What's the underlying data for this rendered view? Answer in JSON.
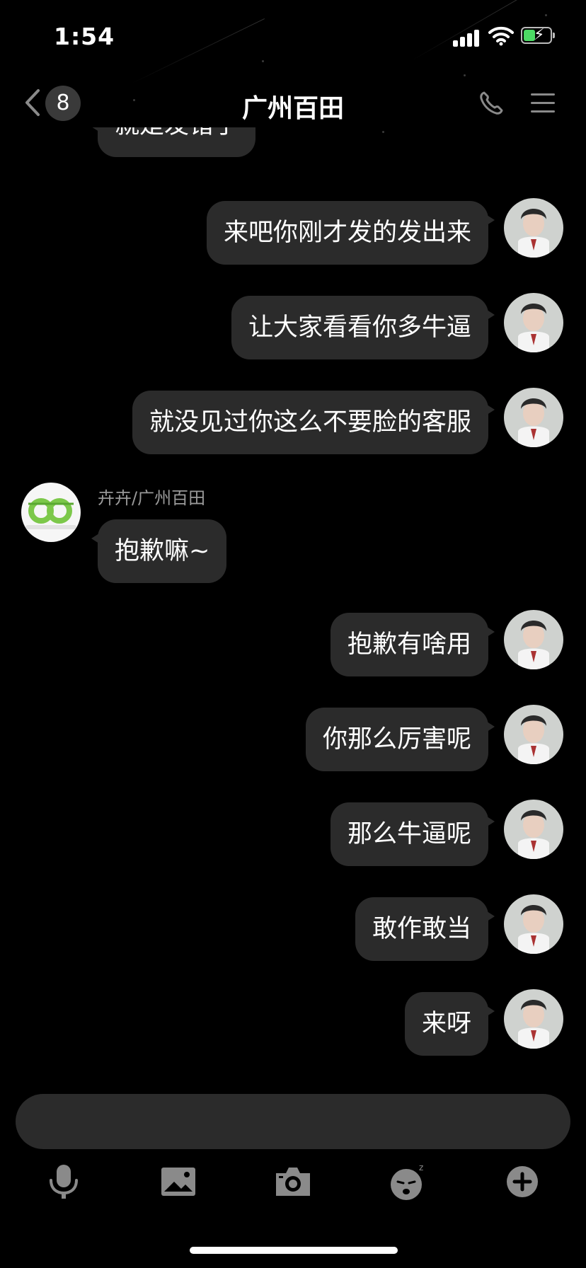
{
  "status_bar": {
    "time": "1:54"
  },
  "header": {
    "unread_count": "8",
    "title": "广州百田"
  },
  "messages": {
    "partial_top": "就是发错了",
    "out_1": "来吧你刚才发的发出来",
    "out_2": "让大家看看你多牛逼",
    "out_3": "就没见过你这么不要脸的客服",
    "sender_name": "卉卉/广州百田",
    "in_1": "抱歉嘛~",
    "out_4": "抱歉有啥用",
    "out_5": "你那么厉害呢",
    "out_6": "那么牛逼呢",
    "out_7": "敢作敢当",
    "out_8": "来呀"
  },
  "input": {
    "value": ""
  },
  "icons": {
    "back": "back-chevron-icon",
    "phone": "phone-icon",
    "menu": "menu-icon",
    "voice": "microphone-icon",
    "image": "image-icon",
    "camera": "camera-icon",
    "emoji": "emoji-icon",
    "more": "plus-icon"
  },
  "colors": {
    "background": "#000000",
    "bubble": "#2b2b2b",
    "battery": "#4cd964",
    "icon_gray": "#8a8a8a"
  }
}
